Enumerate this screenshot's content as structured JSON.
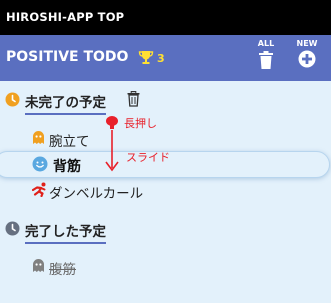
{
  "topbar": {
    "title": "HIROSHI-APP TOP"
  },
  "header": {
    "title": "POSITIVE TODO",
    "trophy_icon": "trophy-icon",
    "trophy_count": "3",
    "all_label": "ALL",
    "new_label": "NEW"
  },
  "sections": {
    "pending": {
      "title": "未完了の予定"
    },
    "done": {
      "title": "完了した予定"
    }
  },
  "todos": {
    "pending": [
      {
        "text": "腕立て",
        "icon": "ghost-icon"
      },
      {
        "text": "背筋",
        "icon": "smiley-icon"
      },
      {
        "text": "ダンベルカール",
        "icon": "running-person-icon"
      }
    ],
    "done": [
      {
        "text": "腹筋",
        "icon": "ghost-icon"
      }
    ]
  },
  "annotations": {
    "long_press": "長押し",
    "slide": "スライド"
  },
  "colors": {
    "topbar": "#000000",
    "header": "#5a6fc0",
    "background": "#e3f1fb",
    "accent_orange": "#f0a020",
    "annotation_red": "#e8202a",
    "trophy_yellow": "#ffe033"
  }
}
